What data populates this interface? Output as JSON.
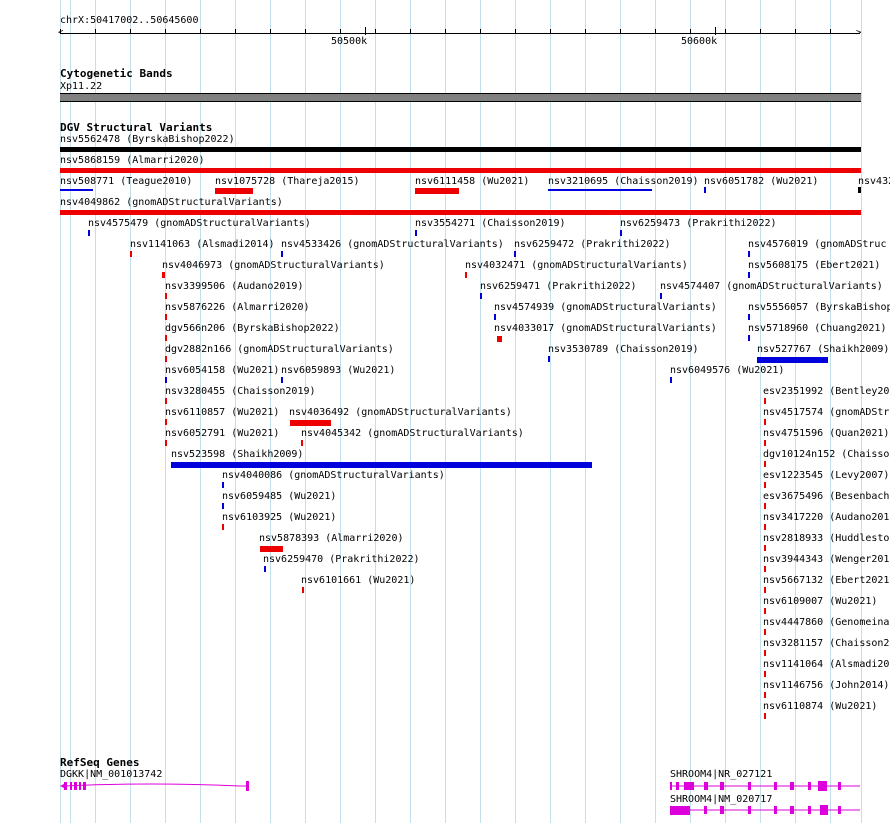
{
  "ruler": {
    "position": "chrX:50417002..50645600",
    "left_arrow": "<",
    "right_arrow": ">",
    "labels": [
      "50500k",
      "50600k"
    ]
  },
  "cytoband": {
    "title": "Cytogenetic Bands",
    "band_label": "Xp11.22",
    "band_color": "#808080"
  },
  "dgv": {
    "title": "DGV Structural Variants",
    "colors": {
      "gain": "#ee0000",
      "loss": "#0000dd",
      "complex": "#000000"
    },
    "features": [
      {
        "text": "nsv5562478 (ByrskaBishop2022)"
      },
      {
        "text": "nsv5868159 (Almarri2020)"
      },
      {
        "text": "nsv508771 (Teague2010)"
      },
      {
        "text": "nsv1075728 (Thareja2015)"
      },
      {
        "text": "nsv6111458 (Wu2021)"
      },
      {
        "text": "nsv3210695 (Chaisson2019)"
      },
      {
        "text": "nsv6051782 (Wu2021)"
      },
      {
        "text": "nsv432"
      },
      {
        "text": "nsv4049862 (gnomADStructuralVariants)"
      },
      {
        "text": "nsv4575479 (gnomADStructuralVariants)"
      },
      {
        "text": "nsv3554271 (Chaisson2019)"
      },
      {
        "text": "nsv6259473 (Prakrithi2022)"
      },
      {
        "text": "nsv1141063 (Alsmadi2014)"
      },
      {
        "text": "nsv4533426 (gnomADStructuralVariants)"
      },
      {
        "text": "nsv6259472 (Prakrithi2022)"
      },
      {
        "text": "nsv4576019 (gnomADStruc"
      },
      {
        "text": "nsv4046973 (gnomADStructuralVariants)"
      },
      {
        "text": "nsv4032471 (gnomADStructuralVariants)"
      },
      {
        "text": "nsv5608175 (Ebert2021)"
      },
      {
        "text": "nsv3399506 (Audano2019)"
      },
      {
        "text": "nsv6259471 (Prakrithi2022)"
      },
      {
        "text": "nsv4574407 (gnomADStructuralVariants)"
      },
      {
        "text": "nsv5876226 (Almarri2020)"
      },
      {
        "text": "nsv4574939 (gnomADStructuralVariants)"
      },
      {
        "text": "nsv5556057 (ByrskaBishop"
      },
      {
        "text": "dgv566n206 (ByrskaBishop2022)"
      },
      {
        "text": "nsv4033017 (gnomADStructuralVariants)"
      },
      {
        "text": "nsv5718960 (Chuang2021)"
      },
      {
        "text": "dgv2882n166 (gnomADStructuralVariants)"
      },
      {
        "text": "nsv3530789 (Chaisson2019)"
      },
      {
        "text": "nsv527767 (Shaikh2009)"
      },
      {
        "text": "nsv6054158 (Wu2021)"
      },
      {
        "text": "nsv6059893 (Wu2021)"
      },
      {
        "text": "nsv6049576 (Wu2021)"
      },
      {
        "text": "nsv3280455 (Chaisson2019)"
      },
      {
        "text": "esv2351992 (Bentley20"
      },
      {
        "text": "nsv6110857 (Wu2021)"
      },
      {
        "text": "nsv4036492 (gnomADStructuralVariants)"
      },
      {
        "text": "nsv4517574 (gnomADStr"
      },
      {
        "text": "nsv6052791 (Wu2021)"
      },
      {
        "text": "nsv4045342 (gnomADStructuralVariants)"
      },
      {
        "text": "nsv4751596 (Quan2021)"
      },
      {
        "text": "nsv523598 (Shaikh2009)"
      },
      {
        "text": "dgv10124n152 (Chaisso"
      },
      {
        "text": "nsv4040086 (gnomADStructuralVariants)"
      },
      {
        "text": "esv1223545 (Levy2007)"
      },
      {
        "text": "nsv6059485 (Wu2021)"
      },
      {
        "text": "esv3675496 (Besenbach"
      },
      {
        "text": "nsv6103925 (Wu2021)"
      },
      {
        "text": "nsv3417220 (Audano201"
      },
      {
        "text": "nsv5878393 (Almarri2020)"
      },
      {
        "text": "nsv2818933 (Huddlesto"
      },
      {
        "text": "nsv6259470 (Prakrithi2022)"
      },
      {
        "text": "nsv3944343 (Wenger201"
      },
      {
        "text": "nsv6101661 (Wu2021)"
      },
      {
        "text": "nsv5667132 (Ebert2021"
      },
      {
        "text": "nsv6109007 (Wu2021)"
      },
      {
        "text": "nsv4447860 (Genomeina"
      },
      {
        "text": "nsv3281157 (Chaisson2"
      },
      {
        "text": "nsv1141064 (Alsmadi20"
      },
      {
        "text": "nsv1146756 (John2014)"
      },
      {
        "text": "nsv6110874 (Wu2021)"
      }
    ]
  },
  "refseq": {
    "title": "RefSeq Genes",
    "gene_color": "#dd00dd",
    "genes": [
      {
        "text": "DGKK|NM_001013742"
      },
      {
        "text": "SHROOM4|NR_027121"
      },
      {
        "text": "SHROOM4|NM_020717"
      }
    ]
  }
}
